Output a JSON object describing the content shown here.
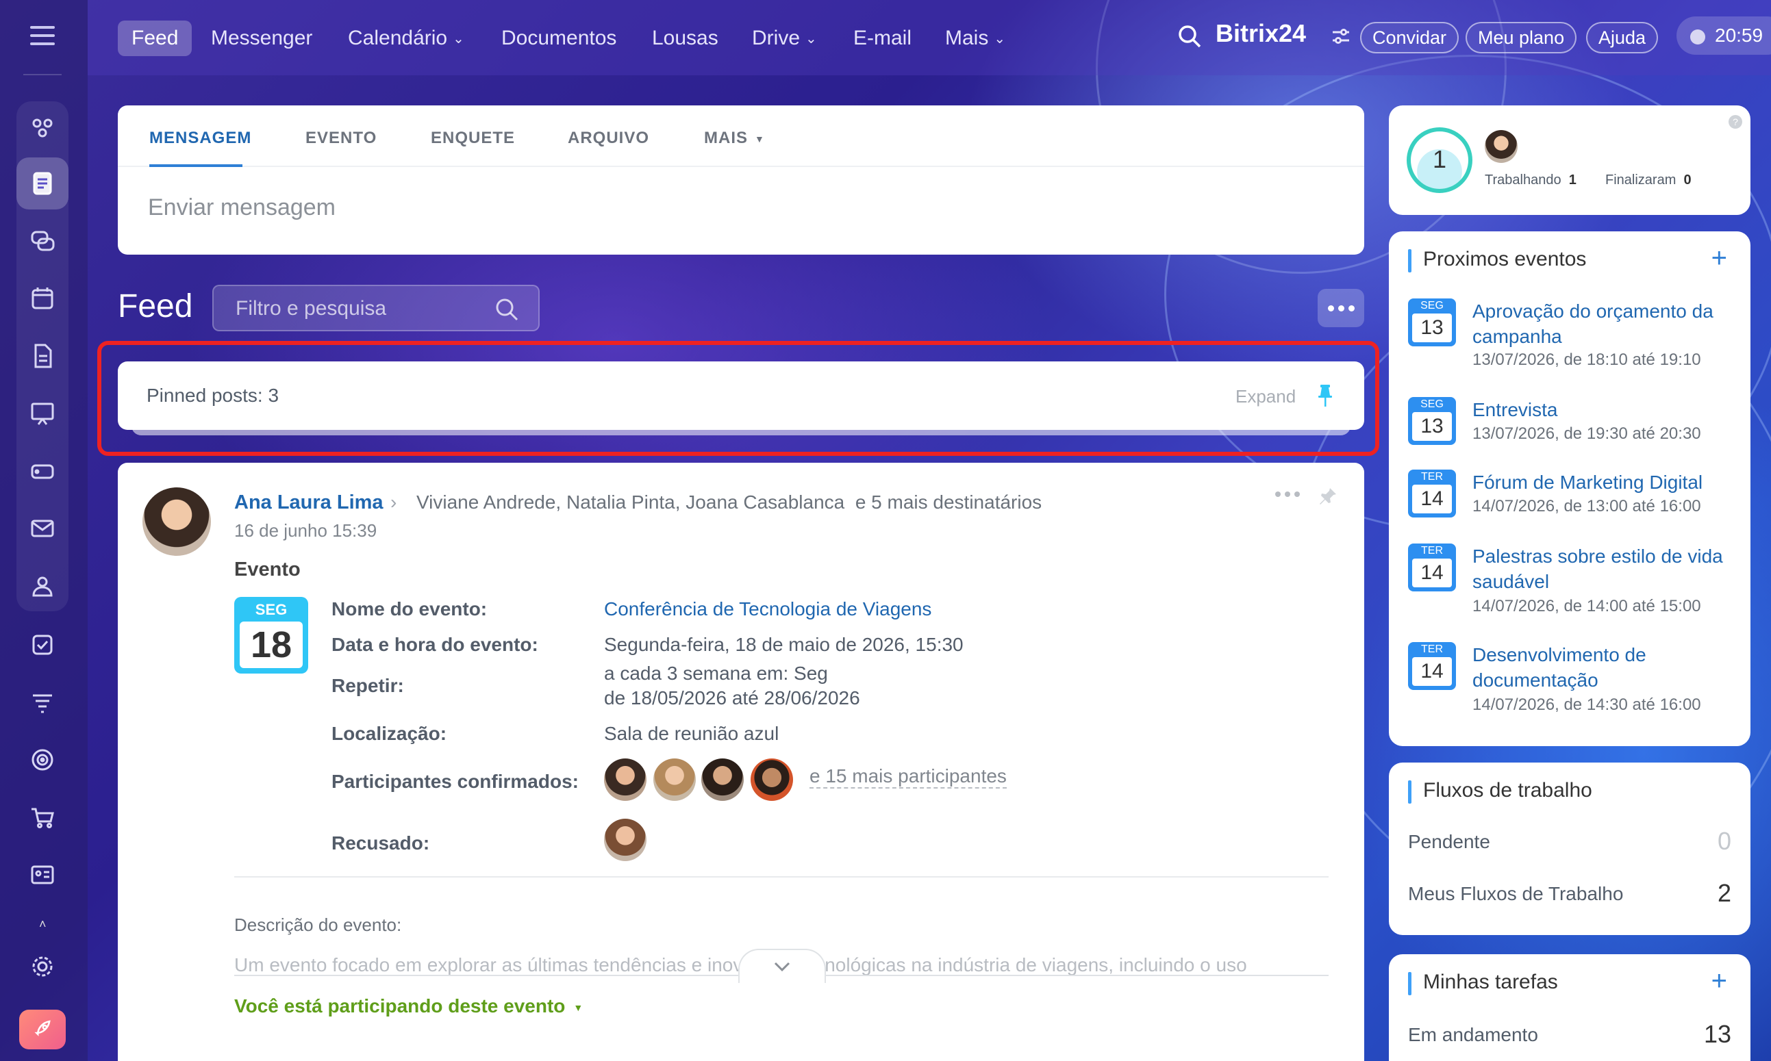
{
  "topnav": {
    "items": [
      {
        "label": "Feed"
      },
      {
        "label": "Messenger"
      },
      {
        "label": "Calendário"
      },
      {
        "label": "Documentos"
      },
      {
        "label": "Lousas"
      },
      {
        "label": "Drive"
      },
      {
        "label": "E-mail"
      },
      {
        "label": "Mais"
      }
    ],
    "brand": "Bitrix24",
    "invite": "Convidar",
    "plan": "Meu plano",
    "help": "Ajuda",
    "clock": "20:59"
  },
  "composer": {
    "tabs": [
      "MENSAGEM",
      "EVENTO",
      "ENQUETE",
      "ARQUIVO",
      "MAIS"
    ],
    "placeholder": "Enviar mensagem"
  },
  "feed": {
    "title": "Feed",
    "search_placeholder": "Filtro e pesquisa",
    "pinned_label": "Pinned posts:",
    "pinned_count": "3",
    "expand": "Expand"
  },
  "post": {
    "author": "Ana Laura Lima",
    "recipients": "Viviane Andrede, Natalia Pinta, Joana Casablanca",
    "recipients_more": "e 5 mais destinatários",
    "date": "16 de junho 15:39",
    "type_label": "Evento",
    "calendar": {
      "month": "SEG",
      "day": "18"
    },
    "fields": {
      "name_label": "Nome do evento:",
      "name_value": "Conferência de Tecnologia de Viagens",
      "datetime_label": "Data e hora do evento:",
      "datetime_value": "Segunda-feira, 18 de maio de 2026, 15:30",
      "repeat_label": "Repetir:",
      "repeat_line1": "a cada 3 semana em: Seg",
      "repeat_line2": "de 18/05/2026 até 28/06/2026",
      "location_label": "Localização:",
      "location_value": "Sala de reunião azul",
      "confirmed_label": "Participantes confirmados:",
      "confirmed_more": "e 15 mais participantes",
      "declined_label": "Recusado:"
    },
    "description_label": "Descrição do evento:",
    "description_text": "Um evento focado em explorar as últimas tendências e inovações tecnológicas na indústria de viagens, incluindo o uso",
    "participating": "Você está participando deste evento"
  },
  "status_widget": {
    "count": "1",
    "working_label": "Trabalhando",
    "working_count": "1",
    "finished_label": "Finalizaram",
    "finished_count": "0"
  },
  "events_widget": {
    "title": "Proximos eventos",
    "events": [
      {
        "month": "SEG",
        "day": "13",
        "title": "Aprovação do orçamento da campanha",
        "time": "13/07/2026, de 18:10 até 19:10"
      },
      {
        "month": "SEG",
        "day": "13",
        "title": "Entrevista",
        "time": "13/07/2026, de 19:30 até 20:30"
      },
      {
        "month": "TER",
        "day": "14",
        "title": "Fórum de Marketing Digital",
        "time": "14/07/2026, de 13:00 até 16:00"
      },
      {
        "month": "TER",
        "day": "14",
        "title": "Palestras sobre estilo de vida saudável",
        "time": "14/07/2026, de 14:00 até 15:00"
      },
      {
        "month": "TER",
        "day": "14",
        "title": "Desenvolvimento de documentação",
        "time": "14/07/2026, de 14:30 até 16:00"
      }
    ]
  },
  "flows_widget": {
    "title": "Fluxos de trabalho",
    "pending_label": "Pendente",
    "pending_count": "0",
    "mine_label": "Meus Fluxos de Trabalho",
    "mine_count": "2"
  },
  "tasks_widget": {
    "title": "Minhas tarefas",
    "in_progress_label": "Em andamento",
    "in_progress_count": "13"
  },
  "colors": {
    "accent": "#2067b0",
    "highlight": "#ee2222",
    "participating": "#5f9e1a"
  }
}
